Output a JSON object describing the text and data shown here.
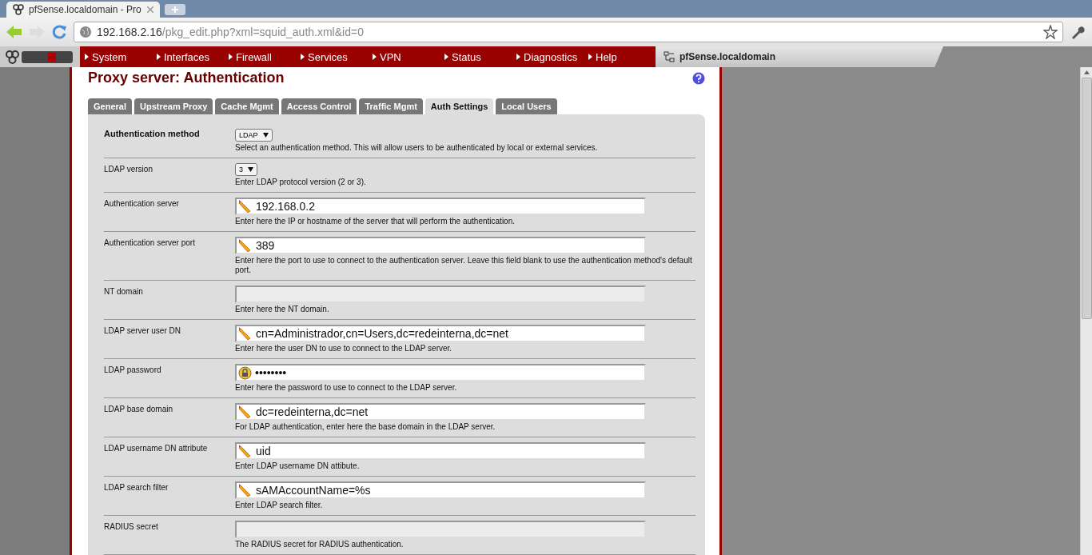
{
  "browser": {
    "tab_title": "pfSense.localdomain - Pro",
    "url_host": "192.168.2.16",
    "url_path": "/pkg_edit.php?xml=squid_auth.xml&id=0"
  },
  "nav": {
    "items": [
      "System",
      "Interfaces",
      "Firewall",
      "Services",
      "VPN",
      "Status",
      "Diagnostics",
      "Help"
    ],
    "host": "pfSense.localdomain"
  },
  "page": {
    "title": "Proxy server: Authentication"
  },
  "tabs": [
    {
      "label": "General",
      "selected": false
    },
    {
      "label": "Upstream Proxy",
      "selected": false
    },
    {
      "label": "Cache Mgmt",
      "selected": false
    },
    {
      "label": "Access Control",
      "selected": false
    },
    {
      "label": "Traffic Mgmt",
      "selected": false
    },
    {
      "label": "Auth Settings",
      "selected": true
    },
    {
      "label": "Local Users",
      "selected": false
    }
  ],
  "fields": [
    {
      "kind": "select",
      "label": "Authentication method",
      "bold": true,
      "value": "LDAP",
      "help": "Select an authentication method. This will allow users to be authenticated by local or external services."
    },
    {
      "kind": "select",
      "label": "LDAP version",
      "bold": false,
      "value": "3",
      "help": "Enter LDAP protocol version (2 or 3)."
    },
    {
      "kind": "text",
      "label": "Authentication server",
      "disabled": false,
      "value": "192.168.0.2",
      "help": "Enter here the IP or hostname of the server that will perform the authentication."
    },
    {
      "kind": "text",
      "label": "Authentication server port",
      "disabled": false,
      "value": "389",
      "help": "Enter here the port to use to connect to the authentication server. Leave this field blank to use the authentication method's default port."
    },
    {
      "kind": "text",
      "label": "NT domain",
      "disabled": true,
      "help": "Enter here the NT domain."
    },
    {
      "kind": "text",
      "label": "LDAP server user DN",
      "disabled": false,
      "value": "cn=Administrador,cn=Users,dc=redeinterna,dc=net",
      "help": "Enter here the user DN to use to connect to the LDAP server."
    },
    {
      "kind": "password",
      "label": "LDAP password",
      "disabled": false,
      "value": "••••••••",
      "help": "Enter here the password to use to connect to the LDAP server."
    },
    {
      "kind": "text",
      "label": "LDAP base domain",
      "disabled": false,
      "value": "dc=redeinterna,dc=net",
      "help": "For LDAP authentication, enter here the base domain in the LDAP server."
    },
    {
      "kind": "text",
      "label": "LDAP username DN attribute",
      "disabled": false,
      "value": "uid",
      "help": "Enter LDAP username DN attibute."
    },
    {
      "kind": "text",
      "label": "LDAP search filter",
      "disabled": false,
      "value": "sAMAccountName=%s",
      "help": "Enter LDAP search filter."
    },
    {
      "kind": "text",
      "label": "RADIUS secret",
      "disabled": true,
      "help": "The RADIUS secret for RADIUS authentication."
    }
  ]
}
